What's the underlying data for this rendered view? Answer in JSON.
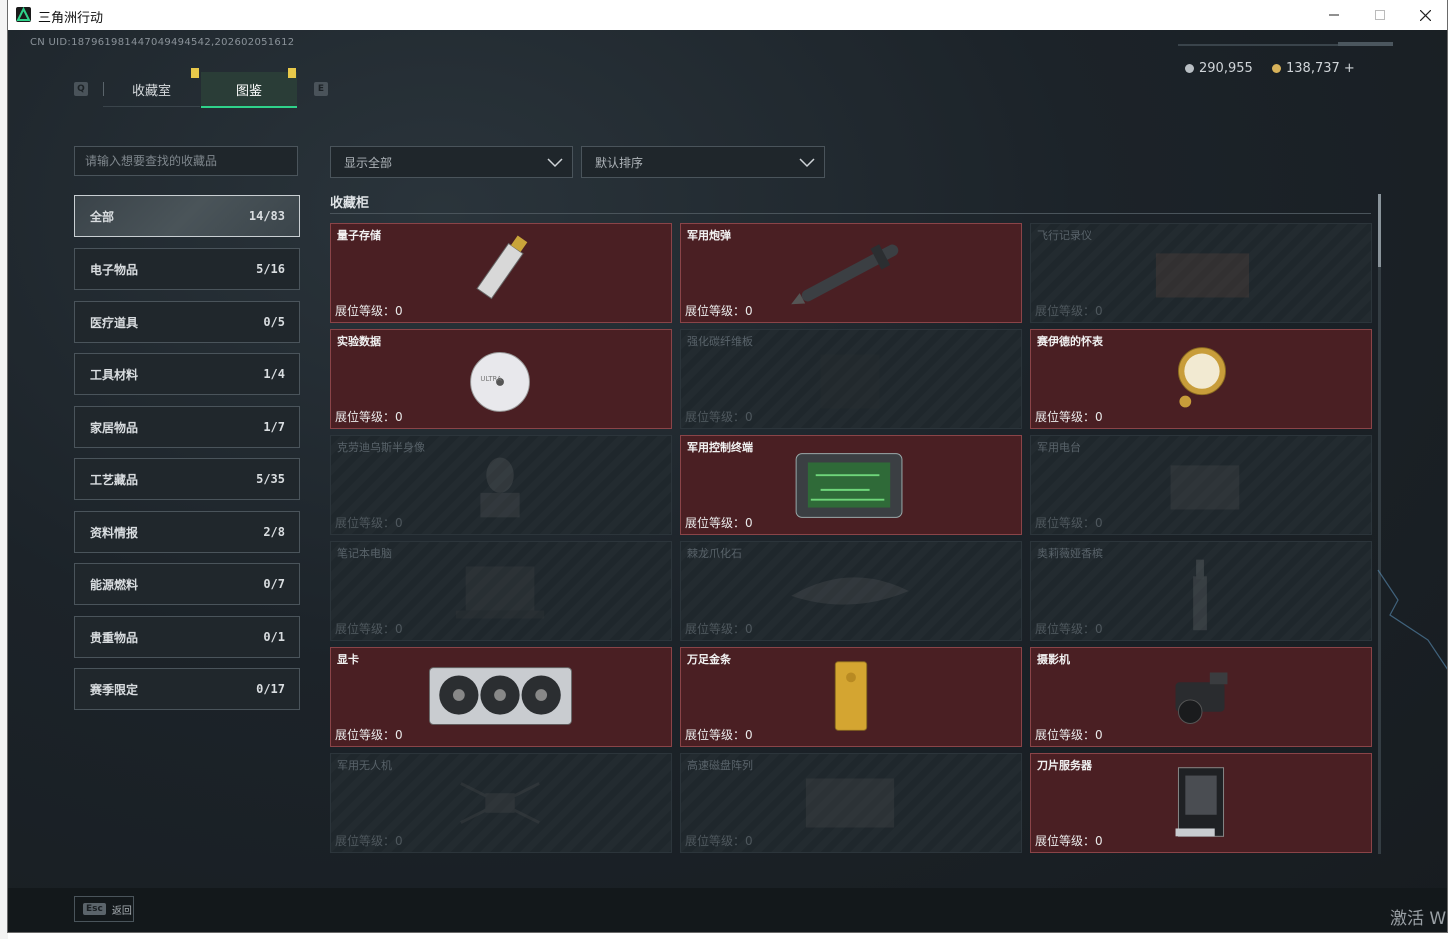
{
  "window": {
    "title": "三角洲行动"
  },
  "header": {
    "uid": "CN UID:187961981447049494542,202602051612",
    "currency": [
      {
        "value": "290,955",
        "color": "#b9bfc4"
      },
      {
        "value": "138,737 +",
        "color": "#d7b25a"
      }
    ]
  },
  "tabs": {
    "left_key": "Q",
    "right_key": "E",
    "items": [
      {
        "label": "收藏室",
        "active": false
      },
      {
        "label": "图鉴",
        "active": true
      }
    ]
  },
  "search": {
    "placeholder": "请输入想要查找的收藏品"
  },
  "filters": {
    "display": "显示全部",
    "sort": "默认排序"
  },
  "categories": [
    {
      "label": "全部",
      "count": "14/83",
      "active": true
    },
    {
      "label": "电子物品",
      "count": "5/16"
    },
    {
      "label": "医疗道具",
      "count": "0/5"
    },
    {
      "label": "工具材料",
      "count": "1/4"
    },
    {
      "label": "家居物品",
      "count": "1/7"
    },
    {
      "label": "工艺藏品",
      "count": "5/35"
    },
    {
      "label": "资料情报",
      "count": "2/8"
    },
    {
      "label": "能源燃料",
      "count": "0/7"
    },
    {
      "label": "贵重物品",
      "count": "0/1"
    },
    {
      "label": "赛季限定",
      "count": "0/17"
    }
  ],
  "cabinet": {
    "title": "收藏柜",
    "level_label": "展位等级：0",
    "items": [
      {
        "name": "量子存储",
        "unlocked": true,
        "icon": "usb-stick-icon"
      },
      {
        "name": "军用炮弹",
        "unlocked": true,
        "icon": "missile-icon"
      },
      {
        "name": "飞行记录仪",
        "unlocked": false,
        "icon": "flight-recorder-icon"
      },
      {
        "name": "实验数据",
        "unlocked": true,
        "icon": "disc-icon"
      },
      {
        "name": "强化碳纤维板",
        "unlocked": false,
        "icon": "carbon-plate-icon"
      },
      {
        "name": "赛伊德的怀表",
        "unlocked": true,
        "icon": "pocket-watch-icon"
      },
      {
        "name": "克劳迪乌斯半身像",
        "unlocked": false,
        "icon": "bust-icon"
      },
      {
        "name": "军用控制终端",
        "unlocked": true,
        "icon": "tablet-terminal-icon"
      },
      {
        "name": "军用电台",
        "unlocked": false,
        "icon": "radio-icon"
      },
      {
        "name": "笔记本电脑",
        "unlocked": false,
        "icon": "laptop-icon"
      },
      {
        "name": "棘龙爪化石",
        "unlocked": false,
        "icon": "fossil-icon"
      },
      {
        "name": "奥莉薇娅香槟",
        "unlocked": false,
        "icon": "champagne-icon"
      },
      {
        "name": "显卡",
        "unlocked": true,
        "icon": "graphics-card-icon"
      },
      {
        "name": "万足金条",
        "unlocked": true,
        "icon": "gold-bar-icon"
      },
      {
        "name": "摄影机",
        "unlocked": true,
        "icon": "camera-icon"
      },
      {
        "name": "军用无人机",
        "unlocked": false,
        "icon": "drone-icon"
      },
      {
        "name": "高速磁盘阵列",
        "unlocked": false,
        "icon": "disk-array-icon"
      },
      {
        "name": "刀片服务器",
        "unlocked": true,
        "icon": "server-icon"
      }
    ]
  },
  "footer": {
    "esc_key": "Esc",
    "back_label": "返回"
  },
  "overlay": {
    "activate_text": "激活 W"
  },
  "colors": {
    "accent": "#2fd28a",
    "unlocked_card": "#4a1f23",
    "tab_marker": "#e8c94a"
  }
}
